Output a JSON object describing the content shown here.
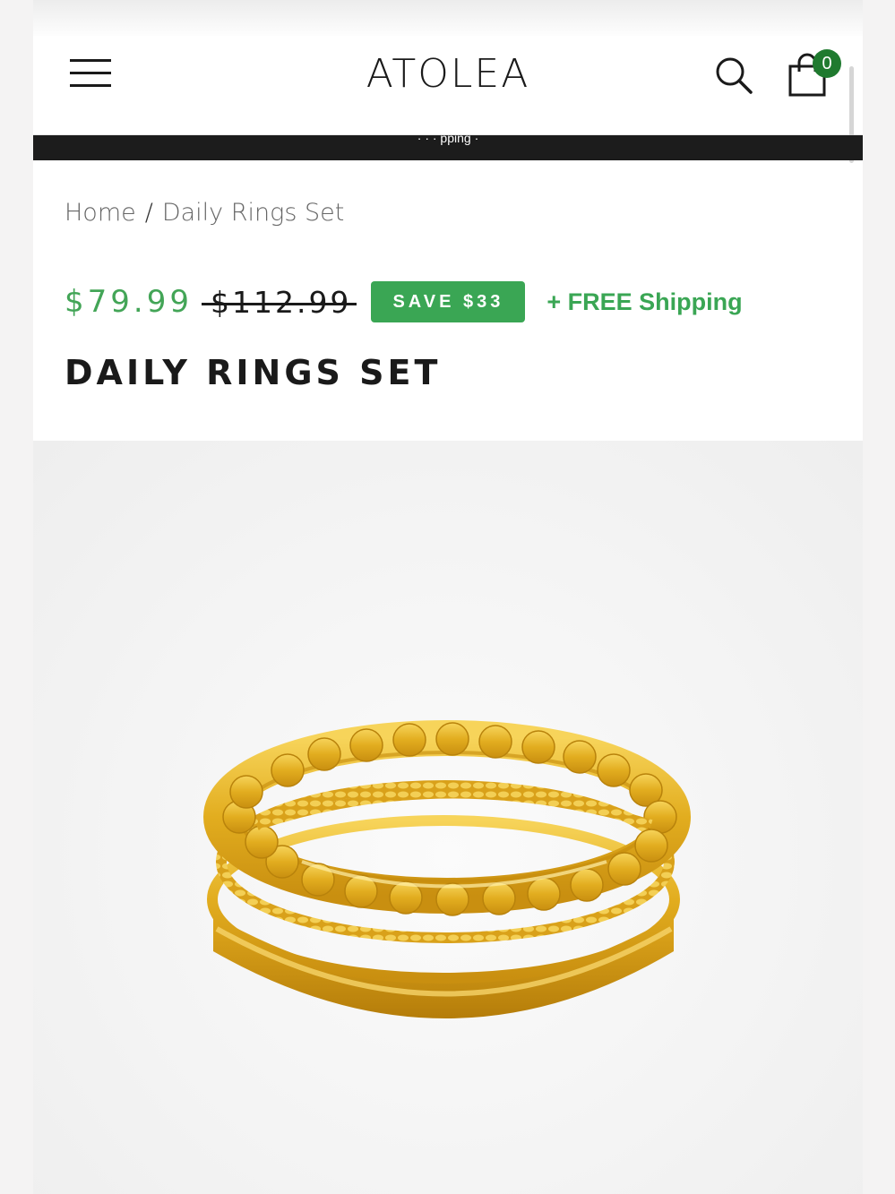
{
  "header": {
    "logo": "ATOLEA",
    "cart_count": "0"
  },
  "announcement": {
    "text": "· · · pping ·"
  },
  "breadcrumb": {
    "home": "Home",
    "separator": "/",
    "current": "Daily Rings Set"
  },
  "pricing": {
    "current_price": "$79.99",
    "original_price": "$112.99",
    "save_badge": "SAVE $33",
    "free_shipping": "+ FREE Shipping"
  },
  "product": {
    "title": "DAILY RINGS SET",
    "image_alt": "Gold rings set"
  },
  "colors": {
    "accent_green": "#3aa654",
    "badge_dark_green": "#1f7a2f",
    "announcement_bg": "#1c1c1c",
    "ring_gold": "#e7b528"
  },
  "icons": [
    "hamburger-menu-icon",
    "search-icon",
    "shopping-bag-icon"
  ]
}
